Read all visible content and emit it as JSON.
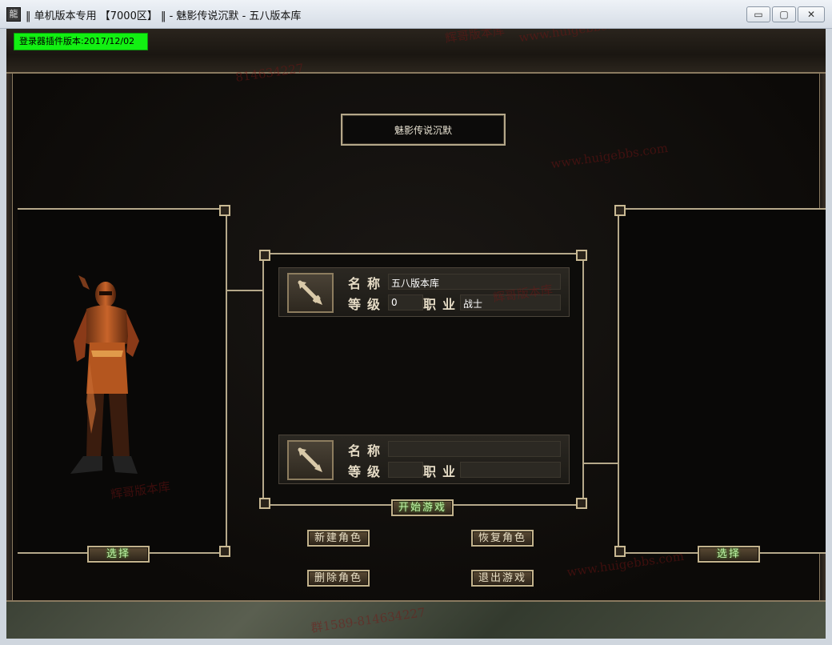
{
  "window": {
    "app_icon": "龍",
    "title": "‖ 单机版本专用 【7000区】 ‖ - 魅影传说沉默 - 五八版本库",
    "minimize": "▭",
    "maximize": "▢",
    "close": "✕"
  },
  "version_badge": "登录器插件版本:2017/12/02",
  "server_name": "魅影传说沉默",
  "slots": [
    {
      "name_label": "名称",
      "name_value": "五八版本库",
      "level_label": "等级",
      "level_value": "0",
      "job_label": "职业",
      "job_value": "战士",
      "icon": "sword-icon"
    },
    {
      "name_label": "名称",
      "name_value": "",
      "level_label": "等级",
      "level_value": "",
      "job_label": "职业",
      "job_value": "",
      "icon": "sword-icon"
    }
  ],
  "buttons": {
    "start_game": "开始游戏",
    "new_char": "新建角色",
    "restore_char": "恢复角色",
    "delete_char": "删除角色",
    "exit_game": "退出游戏",
    "select_left": "选择",
    "select_right": "选择"
  },
  "watermarks": [
    "辉哥版本库",
    "www.huigebbs.com",
    "814634227",
    "群1589-814634227"
  ],
  "colors": {
    "badge": "#12f012",
    "frame": "#b5a88a",
    "watermark": "#7a1414"
  }
}
